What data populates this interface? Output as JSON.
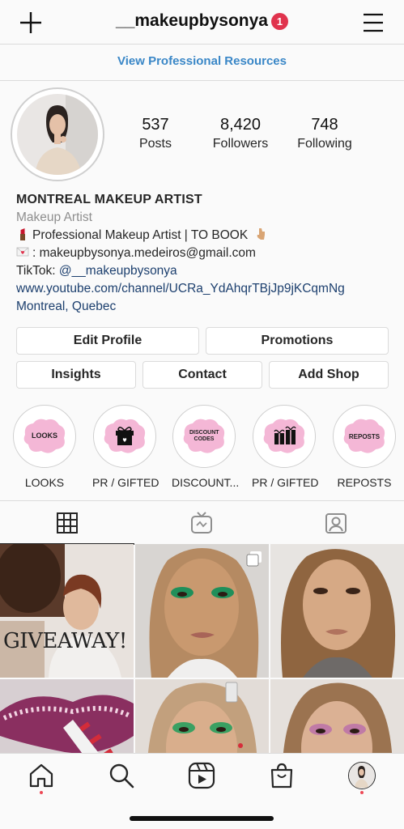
{
  "header": {
    "username": "__makeupbysonya",
    "notification_count": "1",
    "add_icon": "plus-icon",
    "menu_icon": "hamburger-menu-icon"
  },
  "pro_link": "View Professional Resources",
  "stats": [
    {
      "value": "537",
      "label": "Posts"
    },
    {
      "value": "8,420",
      "label": "Followers"
    },
    {
      "value": "748",
      "label": "Following"
    }
  ],
  "bio": {
    "name": "MONTREAL MAKEUP ARTIST",
    "category": "Makeup Artist",
    "line1": "Professional Makeup Artist | TO BOOK",
    "line2": ": makeupbysonya.medeiros@gmail.com",
    "line3_prefix": "TikTok: ",
    "line3_handle": "@__makeupbysonya",
    "link": "www.youtube.com/channel/UCRa_YdAhqrTBjJp9jKCqmNg",
    "location": "Montreal, Quebec"
  },
  "buttons": {
    "edit_profile": "Edit Profile",
    "promotions": "Promotions",
    "insights": "Insights",
    "contact": "Contact",
    "add_shop": "Add Shop"
  },
  "highlights": [
    {
      "label": "LOOKS",
      "cover_text": "LOOKS"
    },
    {
      "label": "PR / GIFTED",
      "cover_text": ""
    },
    {
      "label": "DISCOUNT...",
      "cover_text": "DISCOUNT CODES"
    },
    {
      "label": "PR / GIFTED",
      "cover_text": ""
    },
    {
      "label": "REPOSTS",
      "cover_text": "REPOSTS"
    }
  ],
  "grid": {
    "post1_text": "GIVEAWAY!"
  },
  "colors": {
    "accent_blue": "#3a87c7",
    "badge_red": "#e0334d",
    "highlight_pink": "#f4b7d6"
  }
}
